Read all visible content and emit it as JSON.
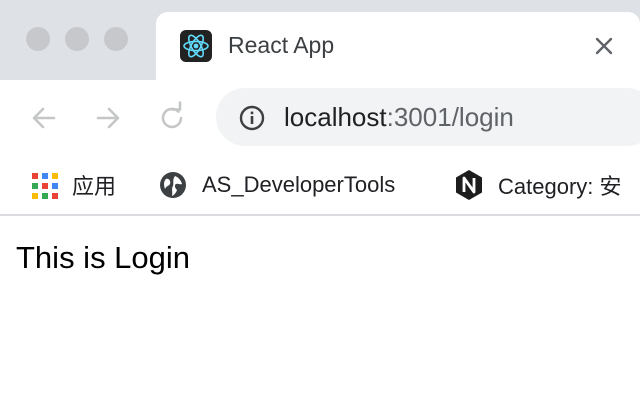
{
  "browser": {
    "tab": {
      "title": "React App",
      "favicon": "react-logo-icon"
    },
    "toolbar": {
      "back_icon": "back-arrow-icon",
      "forward_icon": "forward-arrow-icon",
      "reload_icon": "reload-icon",
      "url_host": "localhost",
      "url_path": ":3001/login"
    },
    "bookmarks": [
      {
        "label": "应用",
        "icon": "apps-grid-icon"
      },
      {
        "label": "AS_DeveloperTools",
        "icon": "globe-icon"
      },
      {
        "label": "Category: 安",
        "icon": "nginx-icon"
      }
    ]
  },
  "page": {
    "text": "This is Login"
  },
  "colors": {
    "tabstrip": "#dee1e6",
    "react_cyan": "#61dafb",
    "nginx_dark": "#1d1d1d"
  }
}
